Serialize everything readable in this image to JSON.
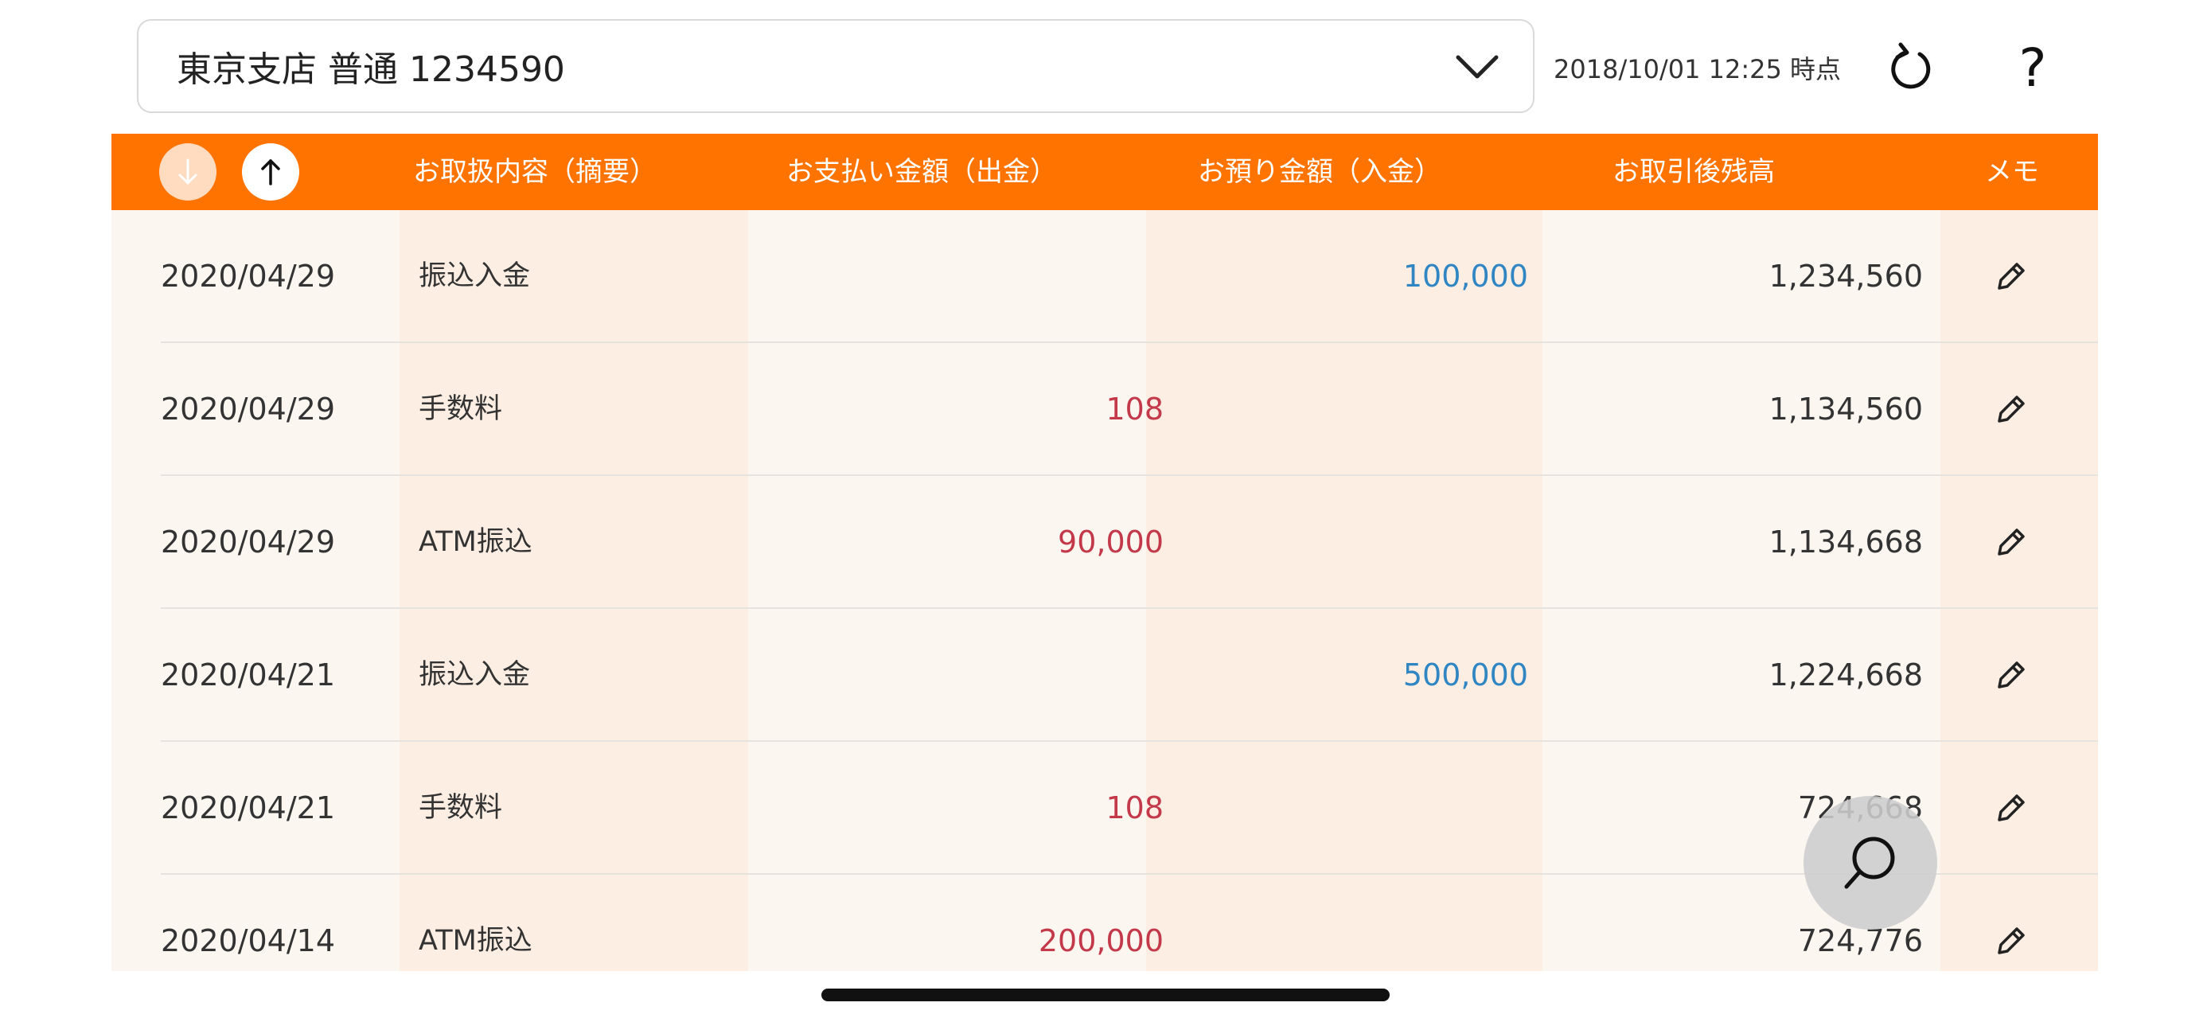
{
  "account": {
    "selected": "東京支店 普通 1234590"
  },
  "status": {
    "timestamp": "2018/10/01 12:25 時点"
  },
  "colors": {
    "header_bg": "#ff7300",
    "withdrawal": "#c4394a",
    "deposit": "#2f86c2"
  },
  "icons": {
    "dropdown": "chevron-down-icon",
    "refresh": "refresh-icon",
    "help": "question-mark-icon",
    "sort_desc": "arrow-down-icon",
    "sort_asc": "arrow-up-icon",
    "memo": "pencil-icon",
    "search": "search-icon"
  },
  "help_label": "?",
  "table": {
    "headers": {
      "description": "お取扱内容（摘要）",
      "withdrawal": "お支払い金額（出金）",
      "deposit": "お預り金額（入金）",
      "balance": "お取引後残高",
      "memo": "メモ"
    },
    "rows": [
      {
        "date": "2020/04/29",
        "description": "振込入金",
        "withdrawal": "",
        "deposit": "100,000",
        "balance": "1,234,560"
      },
      {
        "date": "2020/04/29",
        "description": "手数料",
        "withdrawal": "108",
        "deposit": "",
        "balance": "1,134,560"
      },
      {
        "date": "2020/04/29",
        "description": "ATM振込",
        "withdrawal": "90,000",
        "deposit": "",
        "balance": "1,134,668"
      },
      {
        "date": "2020/04/21",
        "description": "振込入金",
        "withdrawal": "",
        "deposit": "500,000",
        "balance": "1,224,668"
      },
      {
        "date": "2020/04/21",
        "description": "手数料",
        "withdrawal": "108",
        "deposit": "",
        "balance": "724,668"
      },
      {
        "date": "2020/04/14",
        "description": "ATM振込",
        "withdrawal": "200,000",
        "deposit": "",
        "balance": "724,776"
      }
    ]
  }
}
